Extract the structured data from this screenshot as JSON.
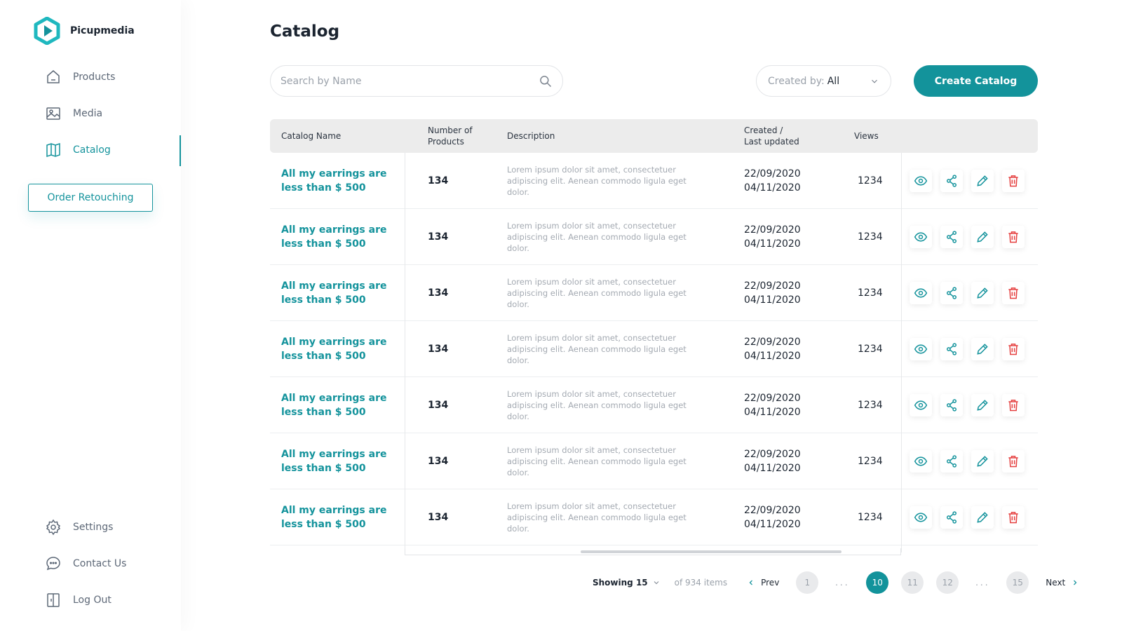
{
  "brand": {
    "name": "Picupmedia",
    "accent": "#14939c",
    "danger": "#e53f3f"
  },
  "sidebar": {
    "items": [
      {
        "label": "Products",
        "icon": "home-icon"
      },
      {
        "label": "Media",
        "icon": "image-icon"
      },
      {
        "label": "Catalog",
        "icon": "book-open-icon",
        "active": true
      }
    ],
    "order_button": "Order Retouching",
    "bottom": [
      {
        "label": "Settings",
        "icon": "gear-icon"
      },
      {
        "label": "Contact Us",
        "icon": "chat-icon"
      },
      {
        "label": "Log Out",
        "icon": "logout-icon"
      }
    ]
  },
  "header": {
    "title": "Catalog",
    "search_placeholder": "Search by Name",
    "filter_label": "Created by:",
    "filter_value": "All",
    "create_button": "Create Catalog"
  },
  "table": {
    "columns": {
      "name": "Catalog Name",
      "num_line1": "Number of",
      "num_line2": "Products",
      "description": "Description",
      "created_line1": "Created /",
      "created_line2": "Last updated",
      "views": "Views"
    },
    "rows": [
      {
        "name": "All my earrings are less than $ 500",
        "products": "134",
        "description": "Lorem ipsum dolor sit amet, consectetuer adipiscing elit. Aenean commodo ligula eget dolor.",
        "created": "22/09/2020",
        "updated": "04/11/2020",
        "views": "1234"
      },
      {
        "name": "All my earrings are less than $ 500",
        "products": "134",
        "description": "Lorem ipsum dolor sit amet, consectetuer adipiscing elit. Aenean commodo ligula eget dolor.",
        "created": "22/09/2020",
        "updated": "04/11/2020",
        "views": "1234"
      },
      {
        "name": "All my earrings are less than $ 500",
        "products": "134",
        "description": "Lorem ipsum dolor sit amet, consectetuer adipiscing elit. Aenean commodo ligula eget dolor.",
        "created": "22/09/2020",
        "updated": "04/11/2020",
        "views": "1234"
      },
      {
        "name": "All my earrings are less than $ 500",
        "products": "134",
        "description": "Lorem ipsum dolor sit amet, consectetuer adipiscing elit. Aenean commodo ligula eget dolor.",
        "created": "22/09/2020",
        "updated": "04/11/2020",
        "views": "1234"
      },
      {
        "name": "All my earrings are less than $ 500",
        "products": "134",
        "description": "Lorem ipsum dolor sit amet, consectetuer adipiscing elit. Aenean commodo ligula eget dolor.",
        "created": "22/09/2020",
        "updated": "04/11/2020",
        "views": "1234"
      },
      {
        "name": "All my earrings are less than $ 500",
        "products": "134",
        "description": "Lorem ipsum dolor sit amet, consectetuer adipiscing elit. Aenean commodo ligula eget dolor.",
        "created": "22/09/2020",
        "updated": "04/11/2020",
        "views": "1234"
      },
      {
        "name": "All my earrings are less than $ 500",
        "products": "134",
        "description": "Lorem ipsum dolor sit amet, consectetuer adipiscing elit. Aenean commodo ligula eget dolor.",
        "created": "22/09/2020",
        "updated": "04/11/2020",
        "views": "1234"
      }
    ]
  },
  "pagination": {
    "showing": "Showing 15",
    "of_items": "of 934 items",
    "prev": "Prev",
    "next": "Next",
    "dots": "...",
    "pages": [
      "1",
      "10",
      "11",
      "12",
      "15"
    ],
    "current": "10"
  }
}
